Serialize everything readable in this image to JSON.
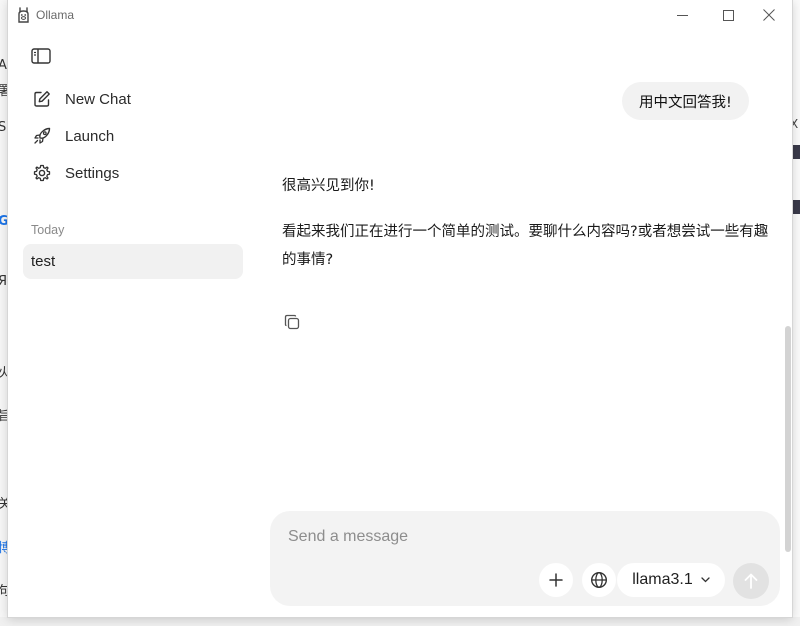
{
  "window": {
    "title": "Ollama"
  },
  "sidebar": {
    "items": [
      {
        "label": "New Chat",
        "icon": "edit-icon"
      },
      {
        "label": "Launch",
        "icon": "rocket-icon"
      },
      {
        "label": "Settings",
        "icon": "gear-icon"
      }
    ],
    "section_label": "Today",
    "chats": [
      {
        "title": "test"
      }
    ]
  },
  "conversation": {
    "user_message": "用中文回答我!",
    "assistant_paragraphs": [
      "很高兴见到你!",
      "看起来我们正在进行一个简单的测试。要聊什么内容吗?或者想尝试一些有趣的事情?"
    ]
  },
  "composer": {
    "placeholder": "Send a message",
    "value": "",
    "model": "llama3.1"
  },
  "colors": {
    "bubble": "#f2f2f2",
    "composer": "#f3f3f3",
    "selected_chat": "#f1f1f1",
    "send_disabled": "#e2e2e2"
  }
}
